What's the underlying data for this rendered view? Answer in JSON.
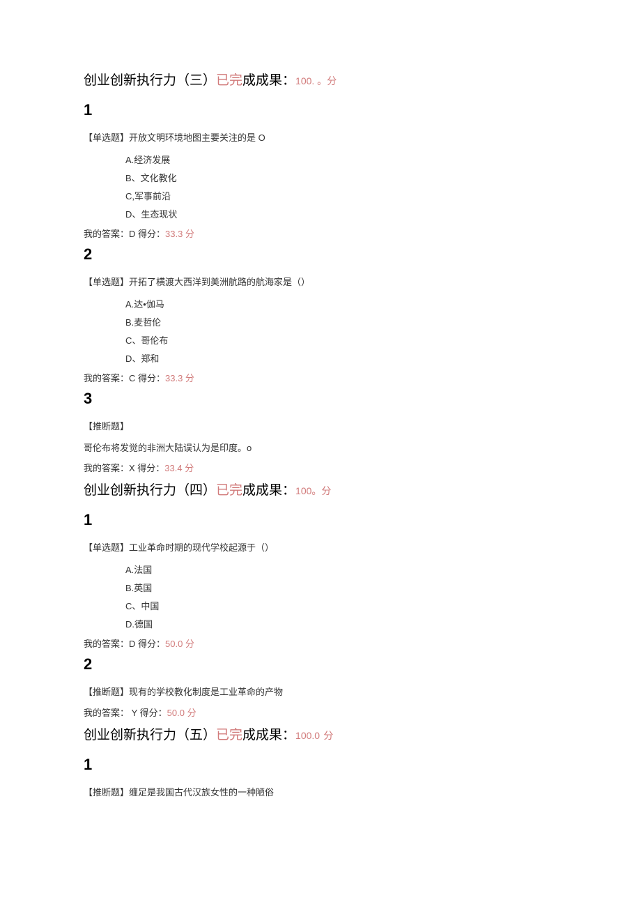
{
  "sections": [
    {
      "title_prefix": "创业创新执行力（三）",
      "completed": "已完",
      "result_label": "成成果：",
      "score": "100. 。",
      "fen": "分",
      "questions": [
        {
          "num": "1",
          "type_label": "【单选题】",
          "stem": "开放文明环境地图主要关注的是 O",
          "options": [
            "A.经济发展",
            "B、文化教化",
            "C,军事前沿",
            "D、生态现状"
          ],
          "answer_prefix": "我的答案：D 得分：",
          "answer_score": "33.3 分"
        },
        {
          "num": "2",
          "type_label": "【单选题】",
          "stem": "开拓了横渡大西洋到美洲航路的航海家是（）",
          "options": [
            "A.达•伽马",
            "B.麦哲伦",
            "C、哥伦布",
            "D、郑和"
          ],
          "answer_prefix": "我的答案：C 得分：",
          "answer_score": "33.3 分"
        },
        {
          "num": "3",
          "type_label": "【推断题】",
          "stem": "",
          "judgment_text": "哥伦布将发觉的非洲大陆误认为是印度。o",
          "options": [],
          "answer_prefix": "我的答案：X 得分：",
          "answer_score": "33.4 分"
        }
      ]
    },
    {
      "title_prefix": "创业创新执行力（四）",
      "completed": "已完",
      "result_label": "成成果：",
      "score": "100。",
      "fen": "分",
      "questions": [
        {
          "num": "1",
          "type_label": "【单选题】",
          "stem": "工业革命时期的现代学校起源于（）",
          "options": [
            "A.法国",
            "B.英国",
            "C、中国",
            "D.德国"
          ],
          "answer_prefix": "我的答案：D 得分：",
          "answer_score": "50.0 分"
        },
        {
          "num": "2",
          "type_label": "【推断题】",
          "stem": "现有的学校教化制度是工业革命的产物",
          "options": [],
          "answer_prefix": "我的答案： Y 得分：",
          "answer_score": "50.0 分"
        }
      ]
    },
    {
      "title_prefix": "创业创新执行力（五）",
      "completed": "已完",
      "result_label": "成成果：",
      "score": "100.0",
      "fen": "分",
      "questions": [
        {
          "num": "1",
          "type_label": "【推断题】",
          "stem": "缠足是我国古代汉族女性的一种陋俗",
          "options": [],
          "answer_prefix": "",
          "answer_score": ""
        }
      ]
    }
  ]
}
